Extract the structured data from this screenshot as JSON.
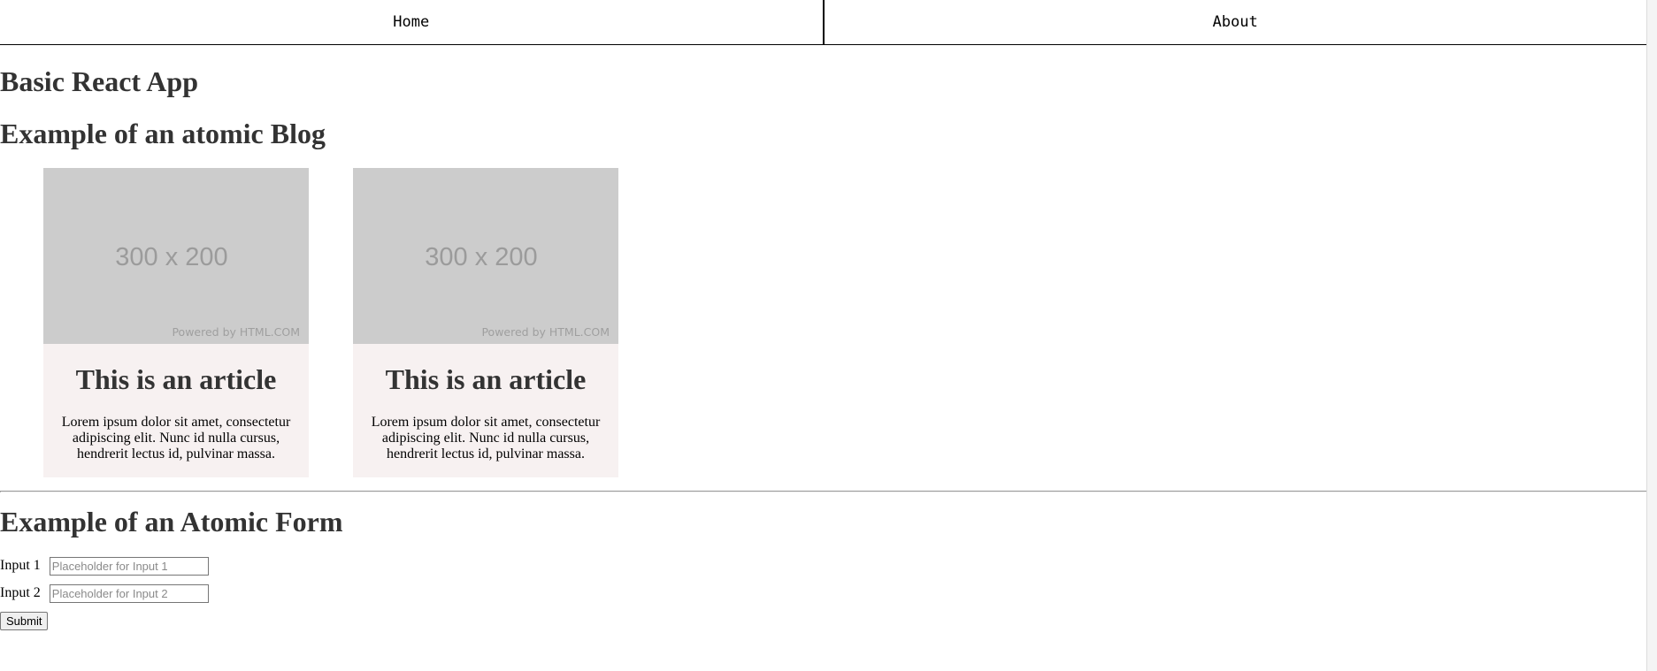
{
  "nav": {
    "items": [
      {
        "label": "Home"
      },
      {
        "label": "About"
      }
    ]
  },
  "page": {
    "title": "Basic React App"
  },
  "blog": {
    "heading": "Example of an atomic Blog",
    "cards": [
      {
        "image_dims": "300 x 200",
        "image_credit": "Powered by HTML.COM",
        "title": "This is an article",
        "body": "Lorem ipsum dolor sit amet, consectetur adipiscing elit. Nunc id nulla cursus, hendrerit lectus id, pulvinar massa."
      },
      {
        "image_dims": "300 x 200",
        "image_credit": "Powered by HTML.COM",
        "title": "This is an article",
        "body": "Lorem ipsum dolor sit amet, consectetur adipiscing elit. Nunc id nulla cursus, hendrerit lectus id, pulvinar massa."
      }
    ]
  },
  "form": {
    "heading": "Example of an Atomic Form",
    "fields": [
      {
        "label": "Input 1",
        "value": "",
        "placeholder": "Placeholder for Input 1"
      },
      {
        "label": "Input 2",
        "value": "",
        "placeholder": "Placeholder for Input 2"
      }
    ],
    "submit_label": "Submit"
  }
}
